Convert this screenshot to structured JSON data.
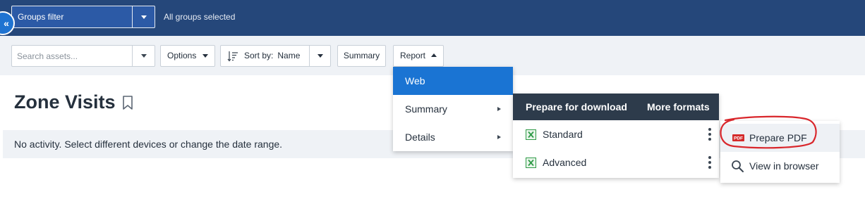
{
  "topbar": {
    "groups_filter_label": "Groups filter",
    "all_groups_text": "All groups selected",
    "collapse_glyph": "«"
  },
  "toolbar": {
    "search_placeholder": "Search assets...",
    "options_label": "Options",
    "sort_label": "Sort by:",
    "sort_value": "Name",
    "summary_label": "Summary",
    "report_label": "Report"
  },
  "page": {
    "title": "Zone Visits",
    "notice": "No activity. Select different devices or change the date range."
  },
  "report_menu": {
    "items": [
      {
        "label": "Web",
        "active": true
      },
      {
        "label": "Summary",
        "has_submenu": true
      },
      {
        "label": "Details",
        "has_submenu": true
      }
    ]
  },
  "summary_submenu": {
    "header_left": "Prepare for download",
    "header_right": "More formats",
    "items": [
      {
        "label": "Standard",
        "icon": "excel-icon"
      },
      {
        "label": "Advanced",
        "icon": "excel-icon"
      }
    ]
  },
  "formats_menu": {
    "items": [
      {
        "label": "Prepare PDF",
        "icon": "pdf-icon",
        "badge": "PDF"
      },
      {
        "label": "View in browser",
        "icon": "magnifier-icon"
      }
    ]
  },
  "colors": {
    "topbar": "#25477a",
    "accent": "#1a74d3",
    "submenu_header": "#2d3b4b",
    "annotation": "#d9262b"
  }
}
